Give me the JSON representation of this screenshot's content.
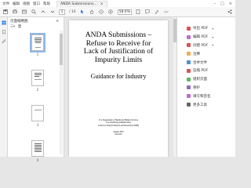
{
  "menu": [
    "文件",
    "编辑",
    "视图",
    "窗口",
    "帮助"
  ],
  "titlebar": {
    "tab_label": "ANDA Submissions...",
    "close_tab": "×"
  },
  "toolbar": {
    "page_current": "1",
    "page_total": "/ 16",
    "zoom": "58.6%"
  },
  "thumbnails": {
    "panel_title": "页面缩略图",
    "pages": [
      "1",
      "2",
      "3",
      "4"
    ]
  },
  "document": {
    "title_lines": [
      "ANDA Submissions –",
      "Refuse to Receive for",
      "Lack of Justification of",
      "Impurity Limits"
    ],
    "subtitle": "Guidance for Industry",
    "agency_lines": [
      "U.S. Department of Health and Human Services",
      "Food and Drug Administration",
      "Center for Drug Evaluation and Research (CDER)"
    ],
    "date_lines": [
      "August 2016",
      "Generics"
    ]
  },
  "tools": [
    {
      "label": "导出 PDF",
      "color": "#d9534f",
      "has_menu": true
    },
    {
      "label": "编辑 PDF",
      "color": "#c06bd0",
      "has_menu": true
    },
    {
      "label": "创建 PDF",
      "color": "#d9534f",
      "has_menu": true
    },
    {
      "label": "注释",
      "color": "#f0ad4e",
      "has_menu": false
    },
    {
      "label": "合并文件",
      "color": "#4a90d9",
      "has_menu": false
    },
    {
      "label": "压缩 PDF",
      "color": "#d9534f",
      "has_menu": false
    },
    {
      "label": "组织页面",
      "color": "#5cb85c",
      "has_menu": false
    },
    {
      "label": "保护",
      "color": "#8e6bbf",
      "has_menu": false
    },
    {
      "label": "填写和签名",
      "color": "#c06bd0",
      "has_menu": false
    },
    {
      "label": "更多工具",
      "color": "#666666",
      "has_menu": false
    }
  ]
}
